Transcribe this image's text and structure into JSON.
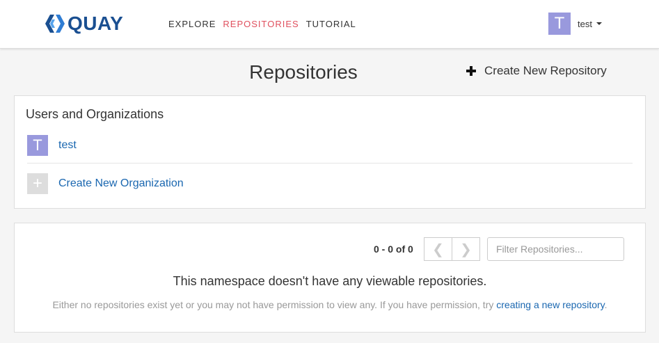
{
  "header": {
    "brand": "QUAY",
    "nav": [
      {
        "label": "EXPLORE",
        "active": false
      },
      {
        "label": "REPOSITORIES",
        "active": true
      },
      {
        "label": "TUTORIAL",
        "active": false
      }
    ],
    "user": {
      "avatar_letter": "T",
      "name": "test"
    }
  },
  "page": {
    "title": "Repositories",
    "create_repo_label": "Create New Repository"
  },
  "orgs": {
    "title": "Users and Organizations",
    "items": [
      {
        "avatar_letter": "T",
        "name": "test"
      }
    ],
    "create_org_icon": "+",
    "create_org_label": "Create New Organization"
  },
  "repos": {
    "count_text": "0 - 0 of 0",
    "prev_icon": "❮",
    "next_icon": "❯",
    "filter_placeholder": "Filter Repositories...",
    "empty_title": "This namespace doesn't have any viewable repositories.",
    "empty_desc_prefix": "Either no repositories exist yet or you may not have permission to view any. If you have permission, try ",
    "empty_desc_link": "creating a new repository",
    "empty_desc_suffix": "."
  },
  "colors": {
    "brand": "#1a4f91",
    "accent": "#e0505e",
    "link": "#1a67b0",
    "avatar": "#9999dd"
  }
}
